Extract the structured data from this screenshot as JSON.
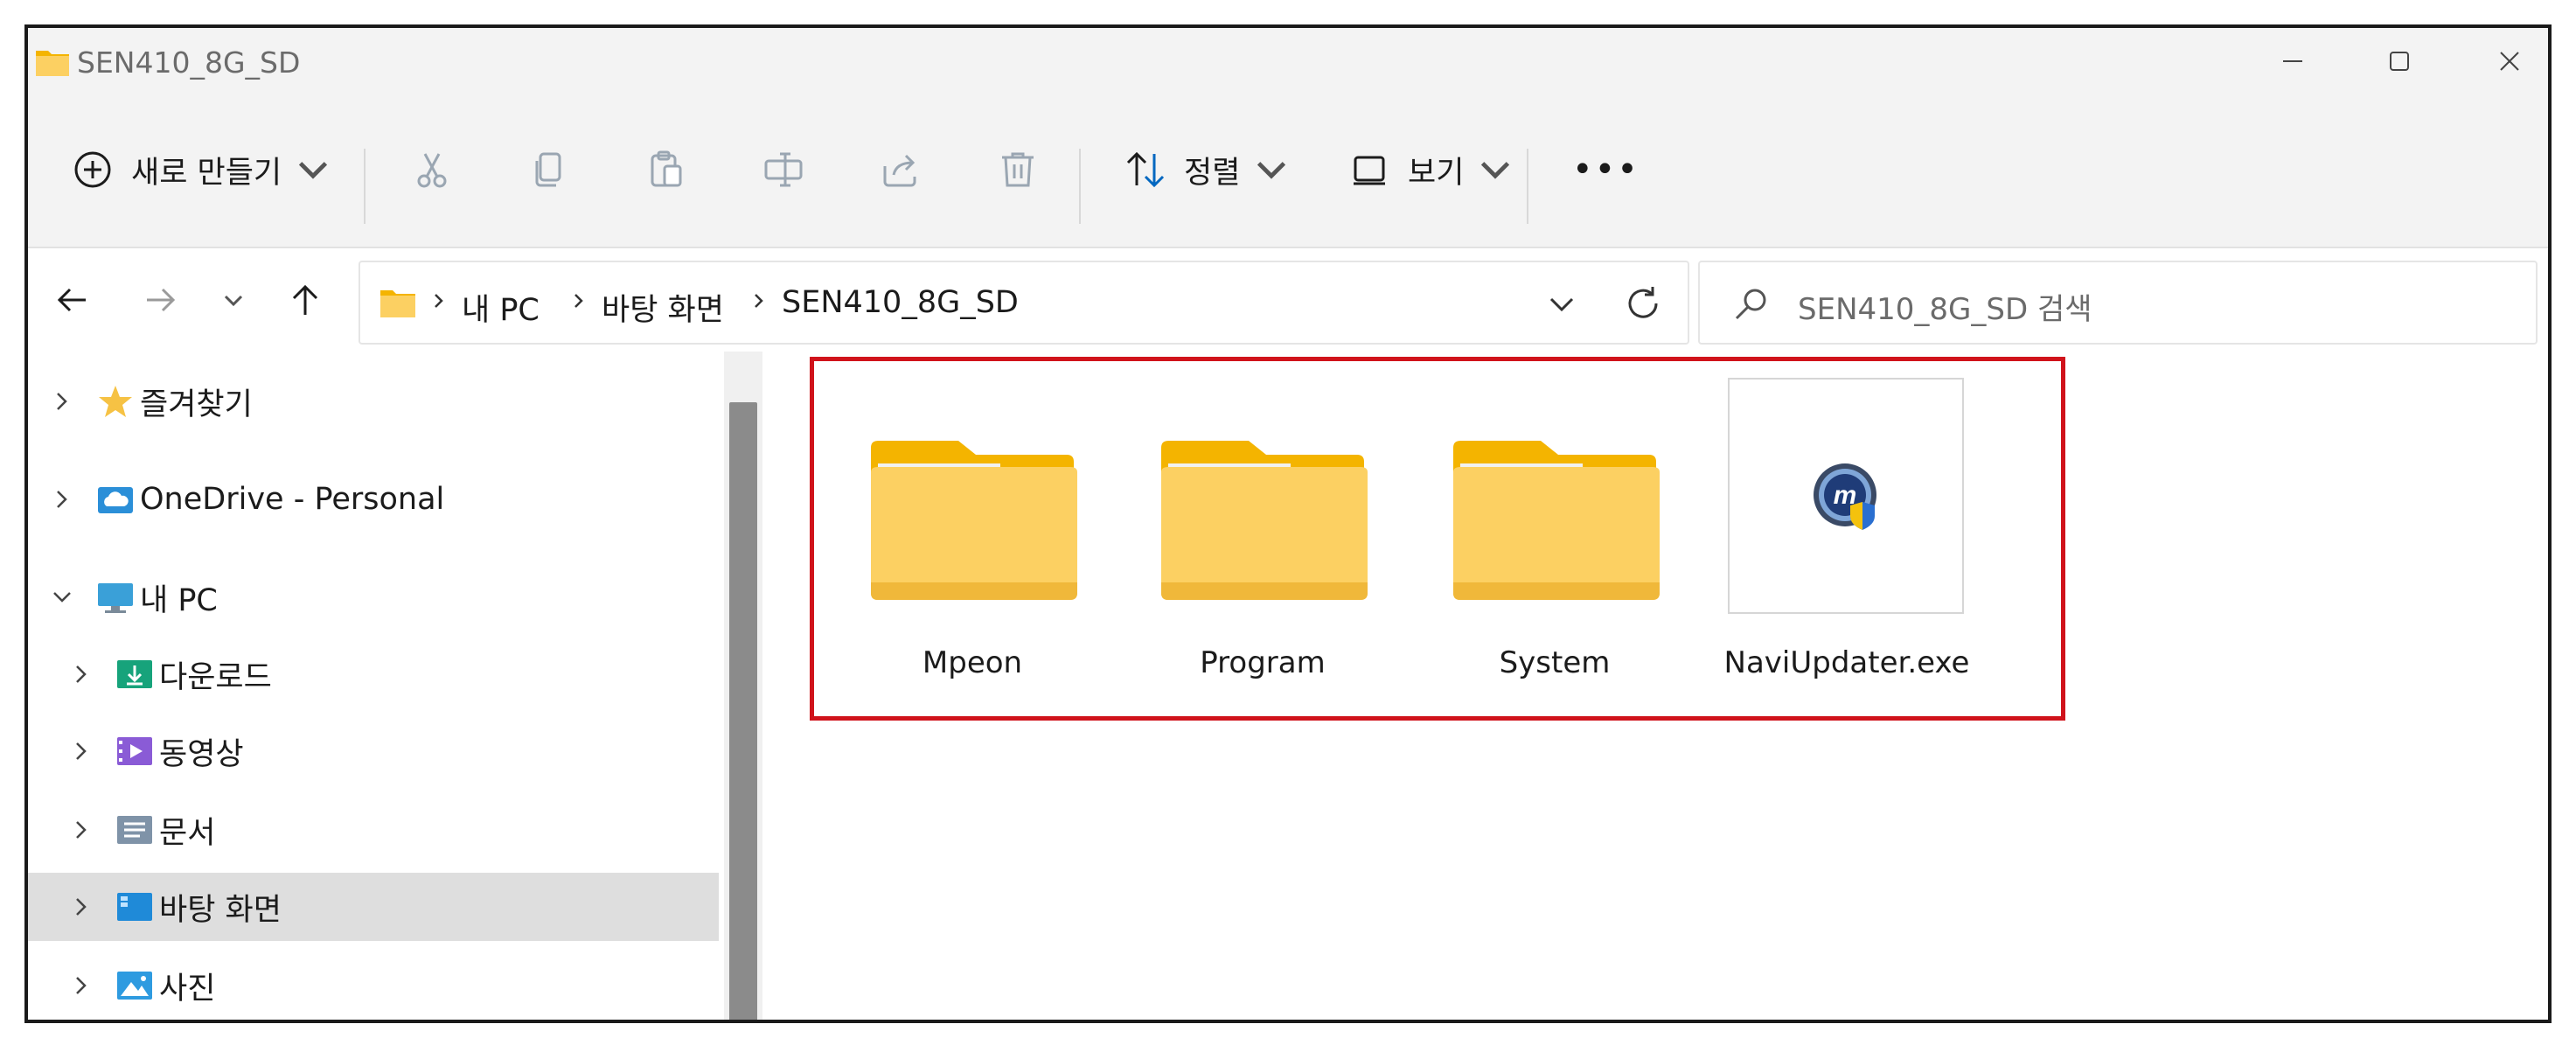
{
  "window": {
    "title": "SEN410_8G_SD"
  },
  "toolbar": {
    "new_label": "새로 만들기",
    "sort_label": "정렬",
    "view_label": "보기",
    "more_label": "•••"
  },
  "address": {
    "crumbs": [
      "내 PC",
      "바탕 화면",
      "SEN410_8G_SD"
    ]
  },
  "search": {
    "placeholder": "SEN410_8G_SD 검색"
  },
  "nav": {
    "items": [
      {
        "label": "즐겨찾기"
      },
      {
        "label": "OneDrive - Personal"
      },
      {
        "label": "내 PC"
      },
      {
        "label": "다운로드"
      },
      {
        "label": "동영상"
      },
      {
        "label": "문서"
      },
      {
        "label": "바탕 화면"
      },
      {
        "label": "사진"
      }
    ]
  },
  "files": [
    {
      "name": "Mpeon",
      "type": "folder"
    },
    {
      "name": "Program",
      "type": "folder"
    },
    {
      "name": "System",
      "type": "folder"
    },
    {
      "name": "NaviUpdater.exe",
      "type": "exe"
    }
  ],
  "colors": {
    "highlight": "#d0131b",
    "folder": "#fcd062",
    "accent": "#0067c0"
  }
}
